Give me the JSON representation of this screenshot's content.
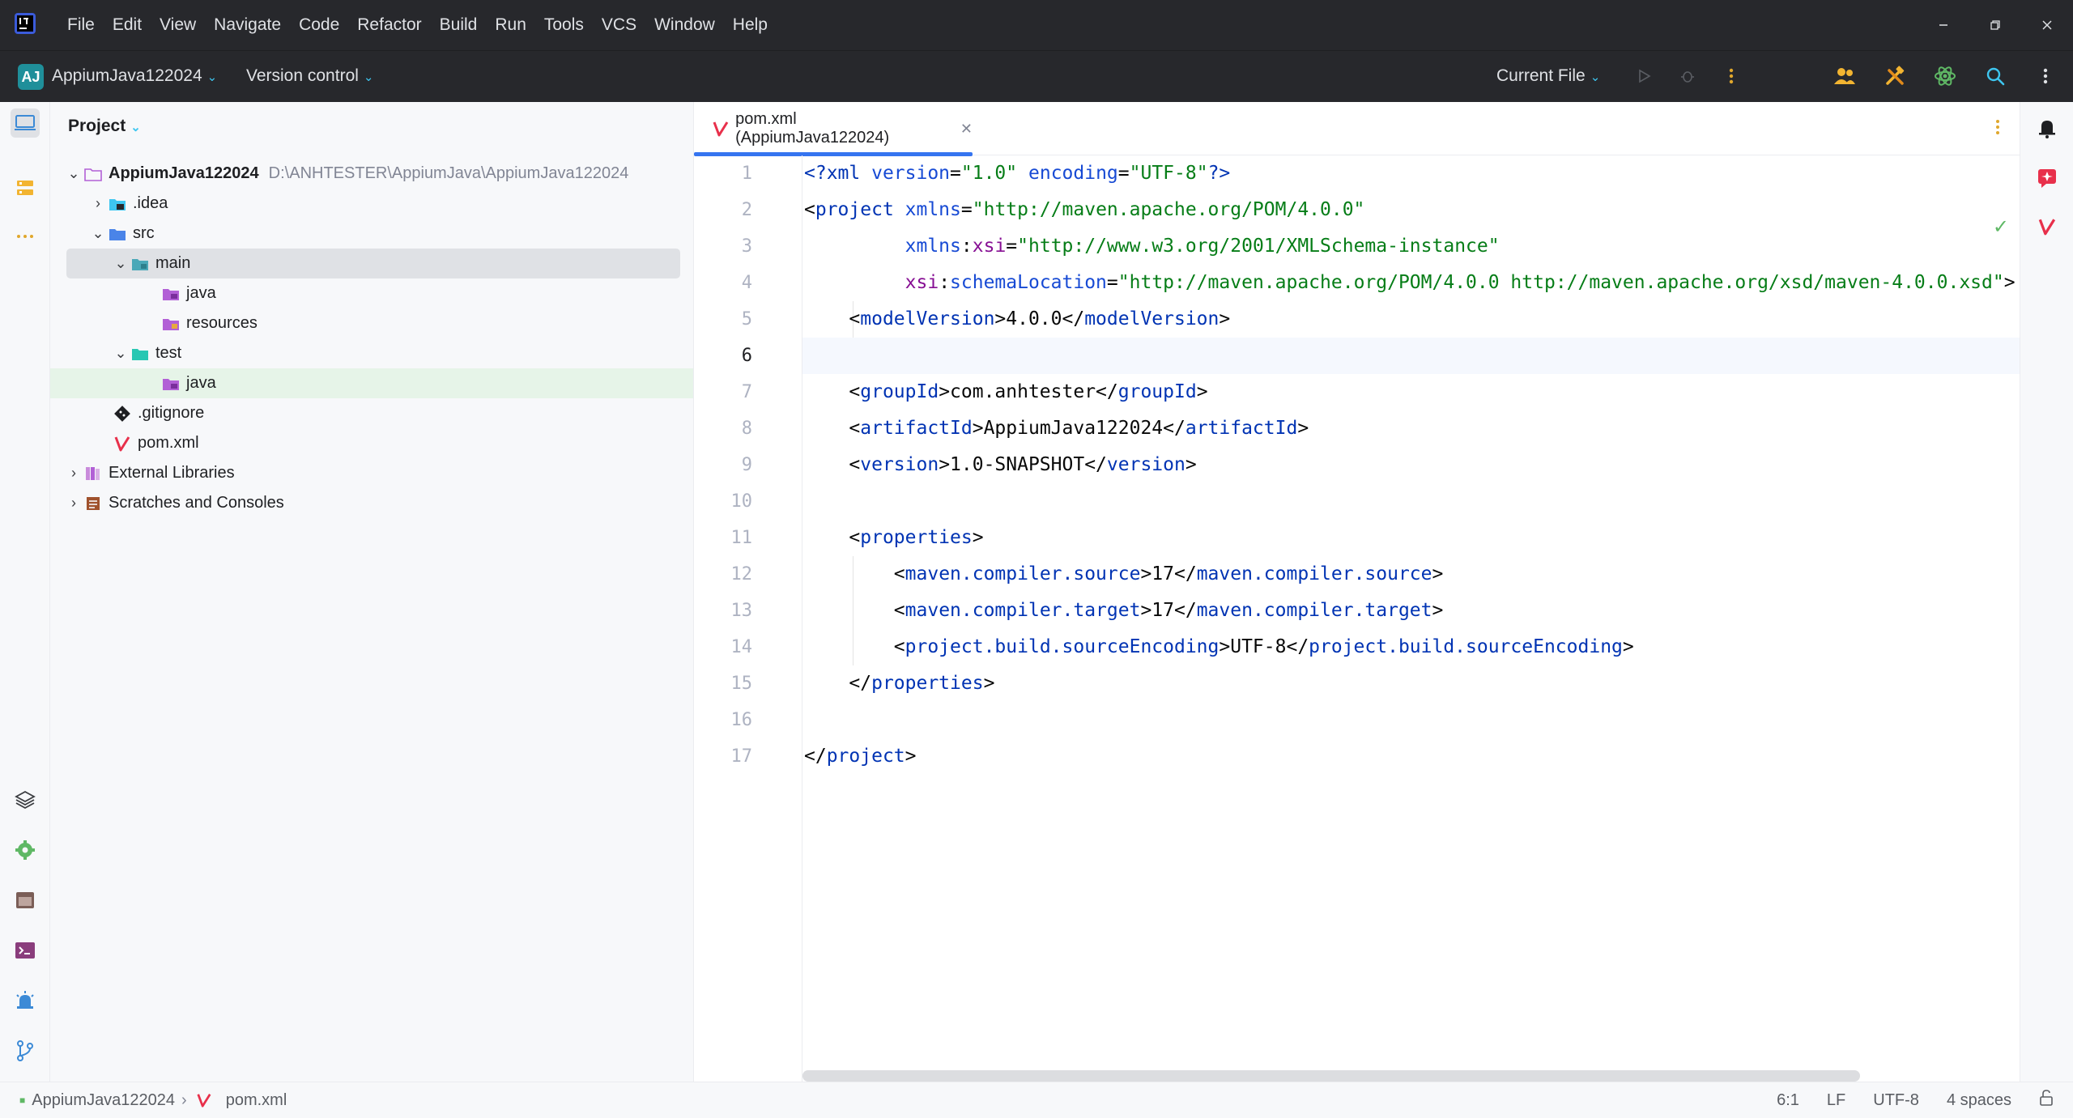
{
  "menu": [
    "File",
    "Edit",
    "View",
    "Navigate",
    "Code",
    "Refactor",
    "Build",
    "Run",
    "Tools",
    "VCS",
    "Window",
    "Help"
  ],
  "toolbar": {
    "project_initials": "AJ",
    "project_name": "AppiumJava122024",
    "version_control": "Version control",
    "run_config": "Current File"
  },
  "project_panel": {
    "title": "Project",
    "root_name": "AppiumJava122024",
    "root_path": "D:\\ANHTESTER\\AppiumJava\\AppiumJava122024",
    "idea": ".idea",
    "src": "src",
    "main": "main",
    "main_java": "java",
    "resources": "resources",
    "test": "test",
    "test_java": "java",
    "gitignore": ".gitignore",
    "pom": "pom.xml",
    "external_libraries": "External Libraries",
    "scratches": "Scratches and Consoles"
  },
  "editor": {
    "tab_label": "pom.xml (AppiumJava122024)",
    "line_numbers": [
      "1",
      "2",
      "3",
      "4",
      "5",
      "6",
      "7",
      "8",
      "9",
      "10",
      "11",
      "12",
      "13",
      "14",
      "15",
      "16",
      "17"
    ],
    "current_line": 6
  },
  "statusbar": {
    "breadcrumb_project": "AppiumJava122024",
    "breadcrumb_file": "pom.xml",
    "caret": "6:1",
    "line_sep": "LF",
    "encoding": "UTF-8",
    "indent": "4 spaces"
  },
  "colors": {
    "accent": "#3574f0",
    "maven": "#e8304b",
    "string": "#067d17",
    "tag": "#0033b3"
  }
}
